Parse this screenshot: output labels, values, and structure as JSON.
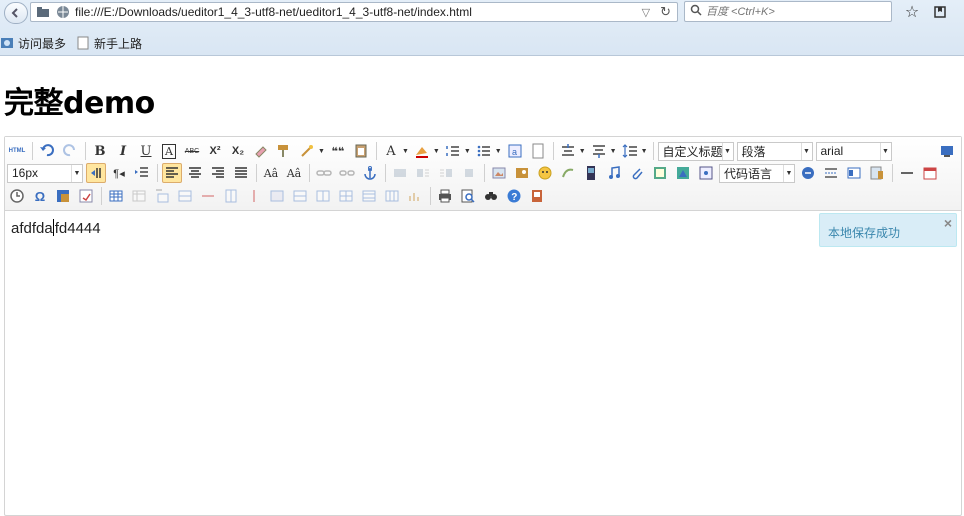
{
  "browser": {
    "url": "file:///E:/Downloads/ueditor1_4_3-utf8-net/ueditor1_4_3-utf8-net/index.html",
    "search_placeholder": "百度 <Ctrl+K>",
    "bookmarks": [
      "访问最多",
      "新手上路"
    ]
  },
  "page": {
    "title": "完整demo"
  },
  "editor": {
    "toolbar": {
      "html_label": "HTML",
      "bold": "B",
      "italic": "I",
      "underline": "U",
      "fontborder": "A",
      "strikethrough": "ABC",
      "superscript": "X²",
      "subscript": "X₂",
      "blockquote": "❝❝",
      "custom_style": "自定义标题",
      "paragraph": "段落",
      "font_family": "arial",
      "font_size": "16px",
      "code_lang": "代码语言"
    },
    "content_before_caret": "afdfda",
    "content_after_caret": "fd4444",
    "toast": "本地保存成功",
    "toast_close": "×"
  }
}
